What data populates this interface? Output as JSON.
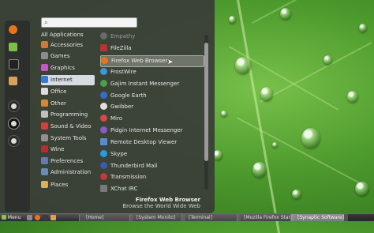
{
  "menu": {
    "search": {
      "placeholder": ""
    },
    "favorites": [
      {
        "name": "firefox-icon",
        "color": "#e8751a"
      },
      {
        "name": "software-manager-icon",
        "color": "#7cc04a"
      },
      {
        "name": "terminal-icon",
        "color": "#2b2b2b"
      },
      {
        "name": "file-manager-icon",
        "color": "#d9a25a"
      }
    ],
    "session": [
      {
        "name": "lock-screen-icon"
      },
      {
        "name": "logout-icon"
      },
      {
        "name": "shutdown-icon"
      }
    ],
    "categories": [
      {
        "label": "All Applications",
        "icon": "",
        "color": ""
      },
      {
        "label": "Accessories",
        "icon": "accessories-icon",
        "color": "#c97b3a"
      },
      {
        "label": "Games",
        "icon": "games-icon",
        "color": "#8c8c8c"
      },
      {
        "label": "Graphics",
        "icon": "graphics-icon",
        "color": "#c05ac0"
      },
      {
        "label": "Internet",
        "icon": "internet-icon",
        "color": "#3a78c8"
      },
      {
        "label": "Office",
        "icon": "office-icon",
        "color": "#dcdcdc"
      },
      {
        "label": "Other",
        "icon": "other-icon",
        "color": "#d08a3a"
      },
      {
        "label": "Programming",
        "icon": "programming-icon",
        "color": "#c0c0c0"
      },
      {
        "label": "Sound & Video",
        "icon": "sound-video-icon",
        "color": "#d04040"
      },
      {
        "label": "System Tools",
        "icon": "system-tools-icon",
        "color": "#909090"
      },
      {
        "label": "Wine",
        "icon": "wine-icon",
        "color": "#b03030"
      },
      {
        "label": "Preferences",
        "icon": "preferences-icon",
        "color": "#6a7ab0"
      },
      {
        "label": "Administration",
        "icon": "administration-icon",
        "color": "#6a8ab0"
      },
      {
        "label": "Places",
        "icon": "places-icon",
        "color": "#d8b060"
      }
    ],
    "selected_category": "Internet",
    "apps": [
      {
        "label": "Empathy",
        "icon": "empathy-icon",
        "color": "#6a6a6a",
        "dim": true
      },
      {
        "label": "FileZilla",
        "icon": "filezilla-icon",
        "color": "#c03030"
      },
      {
        "label": "Firefox Web Browser",
        "icon": "firefox-icon",
        "color": "#e8751a",
        "highlight": true
      },
      {
        "label": "FrostWire",
        "icon": "frostwire-icon",
        "color": "#3a9ad8"
      },
      {
        "label": "Gajim Instant Messenger",
        "icon": "gajim-icon",
        "color": "#4aa04a"
      },
      {
        "label": "Google Earth",
        "icon": "google-earth-icon",
        "color": "#3a6ad0"
      },
      {
        "label": "Gwibber",
        "icon": "gwibber-icon",
        "color": "#e0e0e0"
      },
      {
        "label": "Miro",
        "icon": "miro-icon",
        "color": "#d04a4a"
      },
      {
        "label": "Pidgin Internet Messenger",
        "icon": "pidgin-icon",
        "color": "#8a5ac8"
      },
      {
        "label": "Remote Desktop Viewer",
        "icon": "remote-desktop-icon",
        "color": "#5a8ad0"
      },
      {
        "label": "Skype",
        "icon": "skype-icon",
        "color": "#1ea0e0"
      },
      {
        "label": "Thunderbird Mail",
        "icon": "thunderbird-icon",
        "color": "#3a5ab0"
      },
      {
        "label": "Transmission",
        "icon": "transmission-icon",
        "color": "#c03a3a"
      },
      {
        "label": "XChat IRC",
        "icon": "xchat-icon",
        "color": "#7a7a7a"
      }
    ],
    "description": {
      "title": "Firefox Web Browser",
      "text": "Browse the World Wide Web"
    }
  },
  "taskbar": {
    "menu_label": "Menu",
    "launchers": [
      {
        "name": "show-desktop-icon",
        "color": "#8a8a8a"
      },
      {
        "name": "firefox-launcher-icon",
        "color": "#e8751a"
      },
      {
        "name": "terminal-launcher-icon",
        "color": "#3a3a3a"
      },
      {
        "name": "files-launcher-icon",
        "color": "#d9a25a"
      }
    ],
    "windows": [
      {
        "label": "[Home]",
        "active": false
      },
      {
        "label": "[System Monito]",
        "active": false
      },
      {
        "label": "[Terminal]",
        "active": false
      },
      {
        "label": "[Mozilla Firefox Start",
        "active": false
      },
      {
        "label": "[Synaptic Software]",
        "active": true
      }
    ]
  }
}
